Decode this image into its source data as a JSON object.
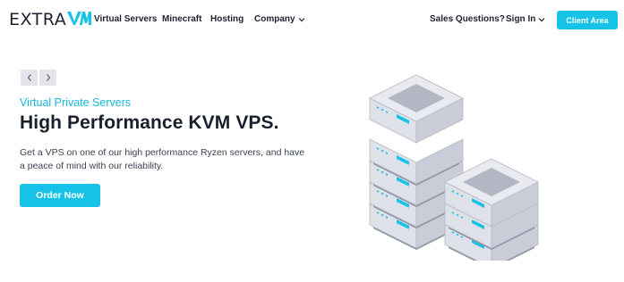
{
  "brand": {
    "logo_text": "EXTRA",
    "logo_mark_icon": "vm-logo-mark",
    "accent_color": "#16c2e8"
  },
  "nav": {
    "links": [
      {
        "label": "Virtual Servers"
      },
      {
        "label": "Minecraft"
      },
      {
        "label": "Hosting"
      },
      {
        "label": "Company"
      }
    ],
    "sales_label": "Sales Questions?",
    "signin_label": "Sign In",
    "client_area_label": "Client Area"
  },
  "hero": {
    "eyebrow": "Virtual Private Servers",
    "title": "High Performance KVM VPS.",
    "description": "Get a VPS on one of our high performance Ryzen servers, and have a peace of mind with our reliability.",
    "cta_label": "Order Now",
    "prev_icon": "chevron-left-icon",
    "next_icon": "chevron-right-icon",
    "illustration": "server-stack-illustration"
  }
}
